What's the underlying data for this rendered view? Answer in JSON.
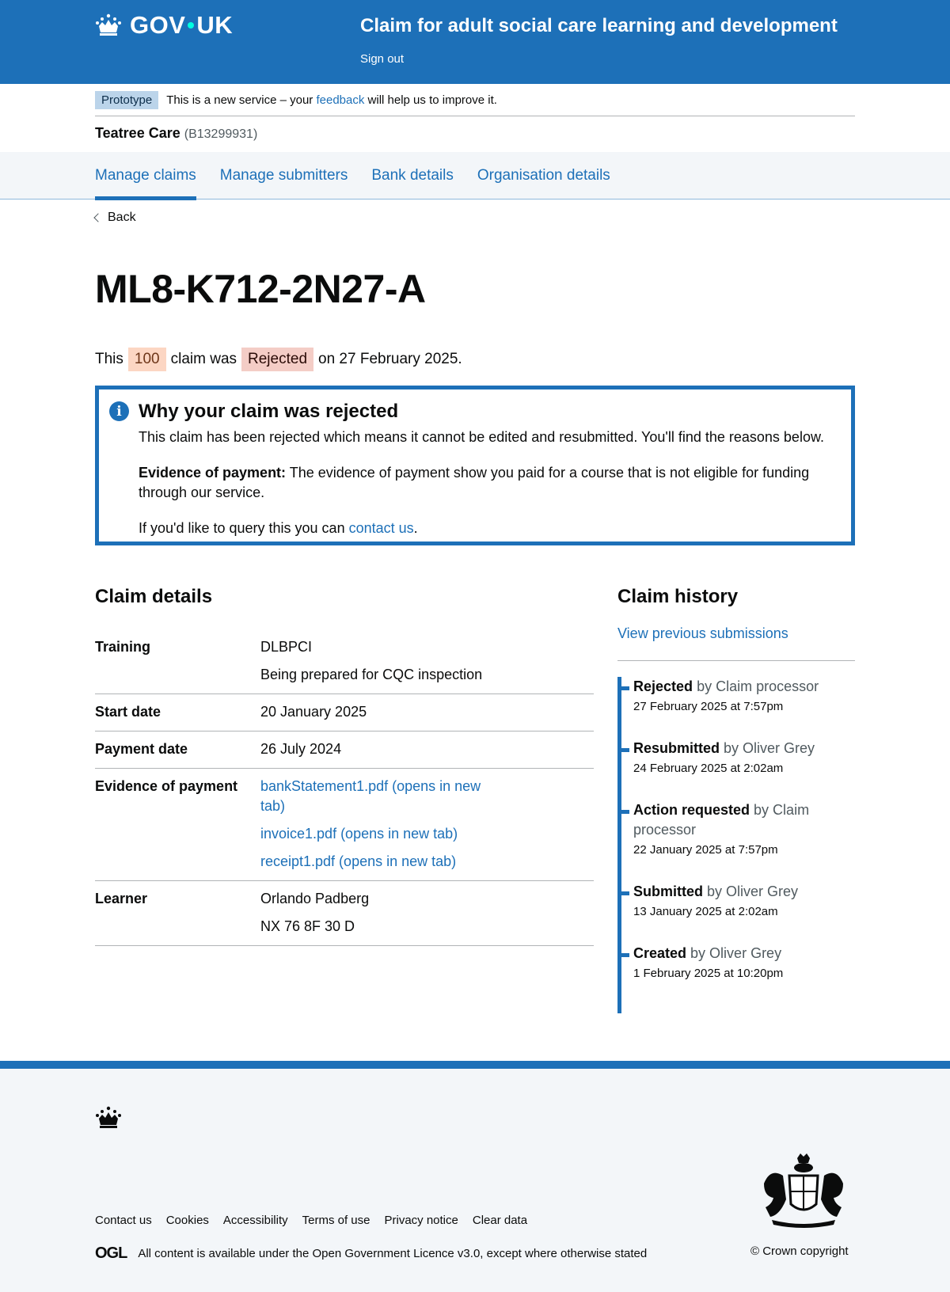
{
  "header": {
    "logo_text_left": "GOV",
    "logo_text_right": "UK",
    "service_name": "Claim for adult social care learning and development",
    "sign_out": "Sign out"
  },
  "phase_banner": {
    "tag": "Prototype",
    "text_before": "This is a new service – your",
    "link": "feedback",
    "text_after": "will help us to improve it."
  },
  "organisation": {
    "name": "Teatree Care",
    "id": "(B13299931)"
  },
  "nav": {
    "items": [
      {
        "label": "Manage claims",
        "active": true
      },
      {
        "label": "Manage submitters",
        "active": false
      },
      {
        "label": "Bank details",
        "active": false
      },
      {
        "label": "Organisation details",
        "active": false
      }
    ]
  },
  "back_link": "Back",
  "page_title": "ML8-K712-2N27-A",
  "status_line": {
    "before": "This",
    "amount_tag": "100",
    "middle": "claim was",
    "status_tag": "Rejected",
    "after": "on 27 February 2025."
  },
  "notice": {
    "title": "Why your claim was rejected",
    "intro": "This claim has been rejected which means it cannot be edited and resubmitted. You'll find the reasons below.",
    "reason_label": "Evidence of payment:",
    "reason_text": "The evidence of payment show you paid for a course that is not eligible for funding through our service.",
    "query_before": "If you'd like to query this you can",
    "query_link": "contact us",
    "query_after": "."
  },
  "claim_details": {
    "heading": "Claim details",
    "rows": {
      "training": {
        "key": "Training",
        "code": "DLBPCI",
        "name": "Being prepared for CQC inspection"
      },
      "start_date": {
        "key": "Start date",
        "value": "20 January 2025"
      },
      "payment_date": {
        "key": "Payment date",
        "value": "26 July 2024"
      },
      "evidence": {
        "key": "Evidence of payment",
        "files": [
          "bankStatement1.pdf (opens in new tab)",
          "invoice1.pdf (opens in new tab)",
          "receipt1.pdf (opens in new tab)"
        ]
      },
      "learner": {
        "key": "Learner",
        "name": "Orlando Padberg",
        "ni": "NX 76 8F 30 D"
      }
    }
  },
  "claim_history": {
    "heading": "Claim history",
    "link": "View previous submissions",
    "events": [
      {
        "action": "Rejected",
        "by": "by Claim processor",
        "date": "27 February 2025 at 7:57pm"
      },
      {
        "action": "Resubmitted",
        "by": "by Oliver Grey",
        "date": "24 February 2025 at 2:02am"
      },
      {
        "action": "Action requested",
        "by": "by Claim processor",
        "date": "22 January 2025 at 7:57pm"
      },
      {
        "action": "Submitted",
        "by": "by Oliver Grey",
        "date": "13 January 2025 at 2:02am"
      },
      {
        "action": "Created",
        "by": "by Oliver Grey",
        "date": "1 February 2025 at 10:20pm"
      }
    ]
  },
  "footer": {
    "links": [
      "Contact us",
      "Cookies",
      "Accessibility",
      "Terms of use",
      "Privacy notice",
      "Clear data"
    ],
    "ogl_logo": "OGL",
    "licence_before": "All content is available under the",
    "licence_link": "Open Government Licence v3.0",
    "licence_after": ", except where otherwise stated",
    "copyright": "© Crown copyright"
  },
  "colors": {
    "brand_blue": "#1d70b8",
    "tag_orange_bg": "#fcd6c3",
    "tag_red_bg": "#f4cdc6",
    "phase_tag_bg": "#bbd4ea"
  }
}
